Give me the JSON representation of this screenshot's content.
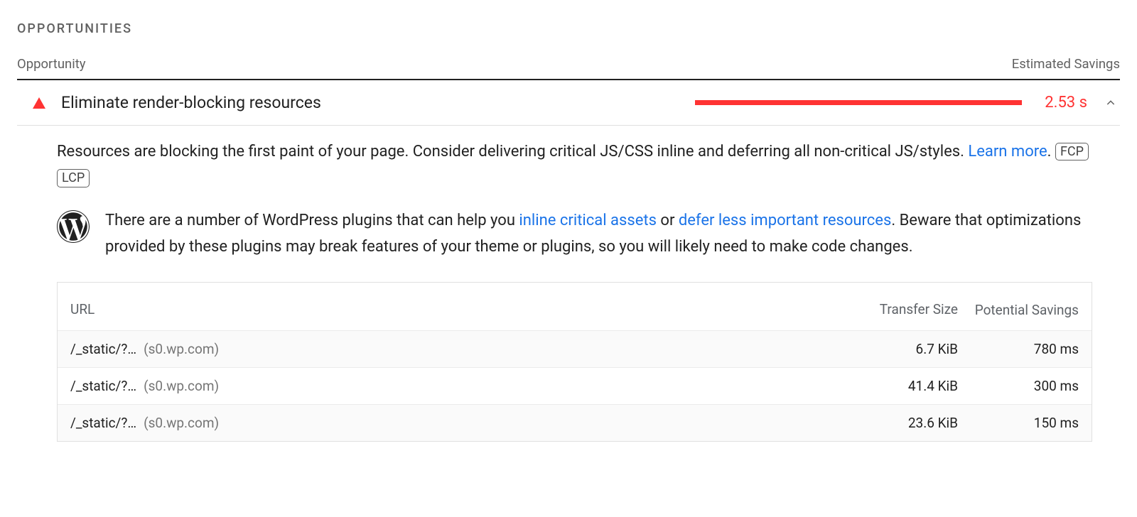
{
  "section": {
    "title": "OPPORTUNITIES"
  },
  "headers": {
    "opportunity": "Opportunity",
    "estimated_savings": "Estimated Savings"
  },
  "audit": {
    "severity": "fail",
    "title": "Eliminate render-blocking resources",
    "savings_display": "2.53 s",
    "expanded": true,
    "description": {
      "pre": "Resources are blocking the first paint of your page. Consider deliverin﻿g critical JS/CSS inline and deferring all non-critical JS/styles. ",
      "learn_more": "Learn more",
      "post": "."
    },
    "badges": [
      "FCP",
      "LCP"
    ],
    "stack": {
      "platform": "wordpress",
      "text_pre": "There are a number of WordPress plugins that can help you ",
      "link1": "inline critical assets",
      "mid": " or ",
      "link2": "defer less important resources",
      "text_post": ". Beware that optimizations provided by these plugins may break features of your theme or plugins, so you will likely need to make code changes."
    },
    "table": {
      "columns": {
        "url": "URL",
        "transfer_size": "Transfer Size",
        "potential_savings": "Potential Savings"
      },
      "rows": [
        {
          "path": "/_static/?…",
          "host": "(s0.wp.com)",
          "transfer_size": "6.7 KiB",
          "potential_savings": "780 ms"
        },
        {
          "path": "/_static/?…",
          "host": "(s0.wp.com)",
          "transfer_size": "41.4 KiB",
          "potential_savings": "300 ms"
        },
        {
          "path": "/_static/?…",
          "host": "(s0.wp.com)",
          "transfer_size": "23.6 KiB",
          "potential_savings": "150 ms"
        }
      ]
    }
  }
}
